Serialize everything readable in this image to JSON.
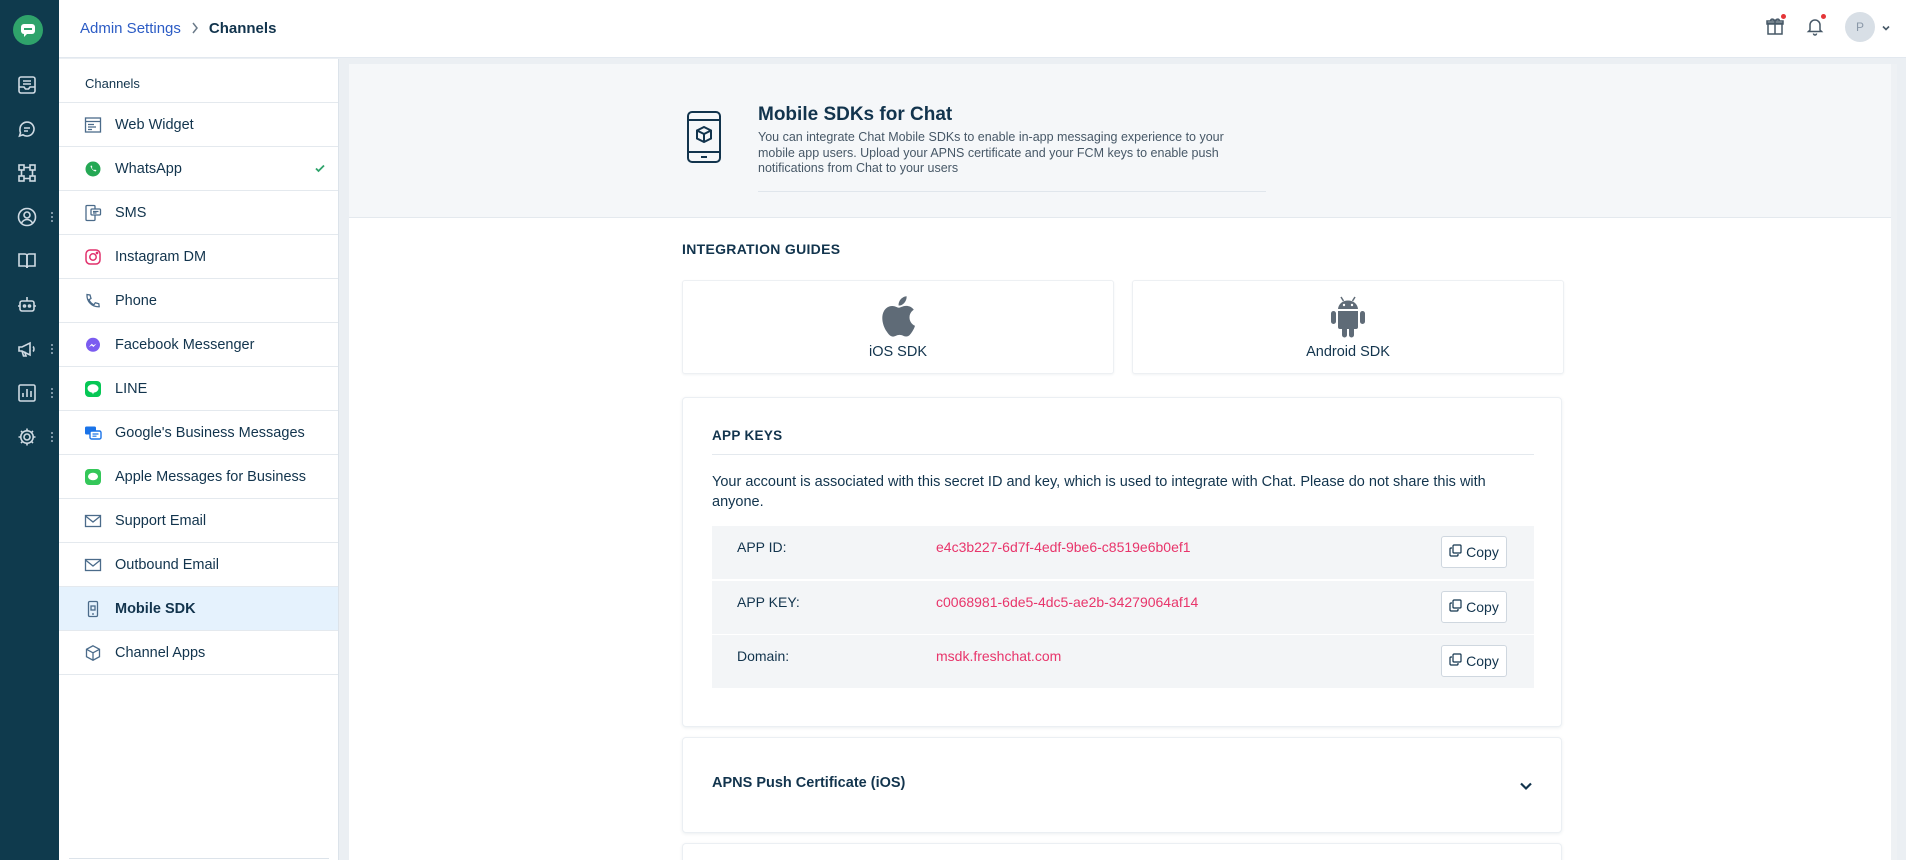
{
  "colors": {
    "rail": "#0f3a4d",
    "brand_green": "#2fa36b",
    "link": "#2c5cc5",
    "key_value": "#e8356b",
    "active_item": "#e5f2fd"
  },
  "rail": {
    "icons": [
      "chat-logo-icon",
      "inbox-icon",
      "conversations-icon",
      "workflows-icon",
      "contacts-icon",
      "knowledge-base-icon",
      "bot-icon",
      "campaigns-icon",
      "reports-icon",
      "settings-icon"
    ]
  },
  "breadcrumb": {
    "parent": "Admin Settings",
    "current": "Channels"
  },
  "header": {
    "avatar_initial": "P"
  },
  "sidebar": {
    "title": "Channels",
    "items": [
      {
        "label": "Web Widget",
        "icon": "web-widget-icon"
      },
      {
        "label": "WhatsApp",
        "icon": "whatsapp-icon",
        "checked": true
      },
      {
        "label": "SMS",
        "icon": "sms-icon"
      },
      {
        "label": "Instagram DM",
        "icon": "instagram-icon"
      },
      {
        "label": "Phone",
        "icon": "phone-icon"
      },
      {
        "label": "Facebook Messenger",
        "icon": "messenger-icon"
      },
      {
        "label": "LINE",
        "icon": "line-icon"
      },
      {
        "label": "Google's Business Messages",
        "icon": "google-business-messages-icon"
      },
      {
        "label": "Apple Messages for Business",
        "icon": "apple-messages-icon"
      },
      {
        "label": "Support Email",
        "icon": "email-icon"
      },
      {
        "label": "Outbound Email",
        "icon": "email-icon"
      },
      {
        "label": "Mobile SDK",
        "icon": "mobile-sdk-icon",
        "active": true
      },
      {
        "label": "Channel Apps",
        "icon": "channel-apps-icon"
      }
    ]
  },
  "hero": {
    "title": "Mobile SDKs for Chat",
    "description": "You can integrate Chat Mobile SDKs to enable in-app messaging experience to your mobile app users. Upload your APNS certificate and your FCM keys to enable push notifications from Chat to your users"
  },
  "guides": {
    "title": "INTEGRATION GUIDES",
    "ios_label": "iOS SDK",
    "android_label": "Android SDK"
  },
  "app_keys": {
    "title": "APP KEYS",
    "description": "Your account is associated with this secret ID and key, which is used to integrate with Chat. Please do not share this with anyone.",
    "copy_label": "Copy",
    "rows": [
      {
        "label": "APP ID:",
        "value": "e4c3b227-6d7f-4edf-9be6-c8519e6b0ef1"
      },
      {
        "label": "APP KEY:",
        "value": "c0068981-6de5-4dc5-ae2b-34279064af14"
      },
      {
        "label": "Domain:",
        "value": "msdk.freshchat.com"
      }
    ]
  },
  "apns": {
    "title": "APNS Push Certificate (iOS)"
  }
}
